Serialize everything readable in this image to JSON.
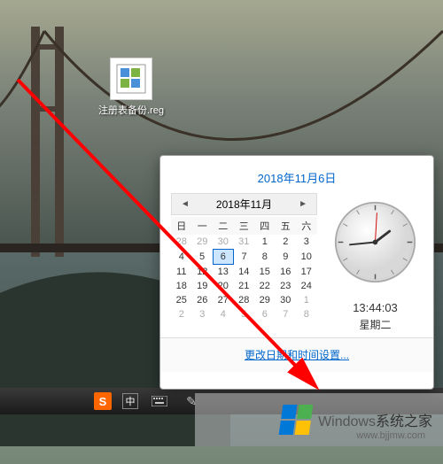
{
  "desktop": {
    "icon_label": "注册表备份.reg"
  },
  "datetime": {
    "date_header": "2018年11月6日",
    "month_label": "2018年11月",
    "weekdays": [
      "日",
      "一",
      "二",
      "三",
      "四",
      "五",
      "六"
    ],
    "cells": [
      {
        "v": "28",
        "other": true
      },
      {
        "v": "29",
        "other": true
      },
      {
        "v": "30",
        "other": true
      },
      {
        "v": "31",
        "other": true
      },
      {
        "v": "1"
      },
      {
        "v": "2"
      },
      {
        "v": "3"
      },
      {
        "v": "4"
      },
      {
        "v": "5"
      },
      {
        "v": "6",
        "selected": true
      },
      {
        "v": "7"
      },
      {
        "v": "8"
      },
      {
        "v": "9"
      },
      {
        "v": "10"
      },
      {
        "v": "11"
      },
      {
        "v": "12"
      },
      {
        "v": "13"
      },
      {
        "v": "14"
      },
      {
        "v": "15"
      },
      {
        "v": "16"
      },
      {
        "v": "17"
      },
      {
        "v": "18"
      },
      {
        "v": "19"
      },
      {
        "v": "20"
      },
      {
        "v": "21"
      },
      {
        "v": "22"
      },
      {
        "v": "23"
      },
      {
        "v": "24"
      },
      {
        "v": "25"
      },
      {
        "v": "26"
      },
      {
        "v": "27"
      },
      {
        "v": "28"
      },
      {
        "v": "29"
      },
      {
        "v": "30"
      },
      {
        "v": "1",
        "other": true
      },
      {
        "v": "2",
        "other": true
      },
      {
        "v": "3",
        "other": true
      },
      {
        "v": "4",
        "other": true
      },
      {
        "v": "5",
        "other": true
      },
      {
        "v": "6",
        "other": true
      },
      {
        "v": "7",
        "other": true
      },
      {
        "v": "8",
        "other": true
      }
    ],
    "time": "13:44:03",
    "day_of_week": "星期二",
    "change_link": "更改日期和时间设置..."
  },
  "watermark": {
    "text1": "Windows",
    "text2": "系统之家",
    "url": "www.bjjmw.com"
  },
  "taskbar": {
    "ime_icon": "S",
    "ime_box": "中"
  }
}
